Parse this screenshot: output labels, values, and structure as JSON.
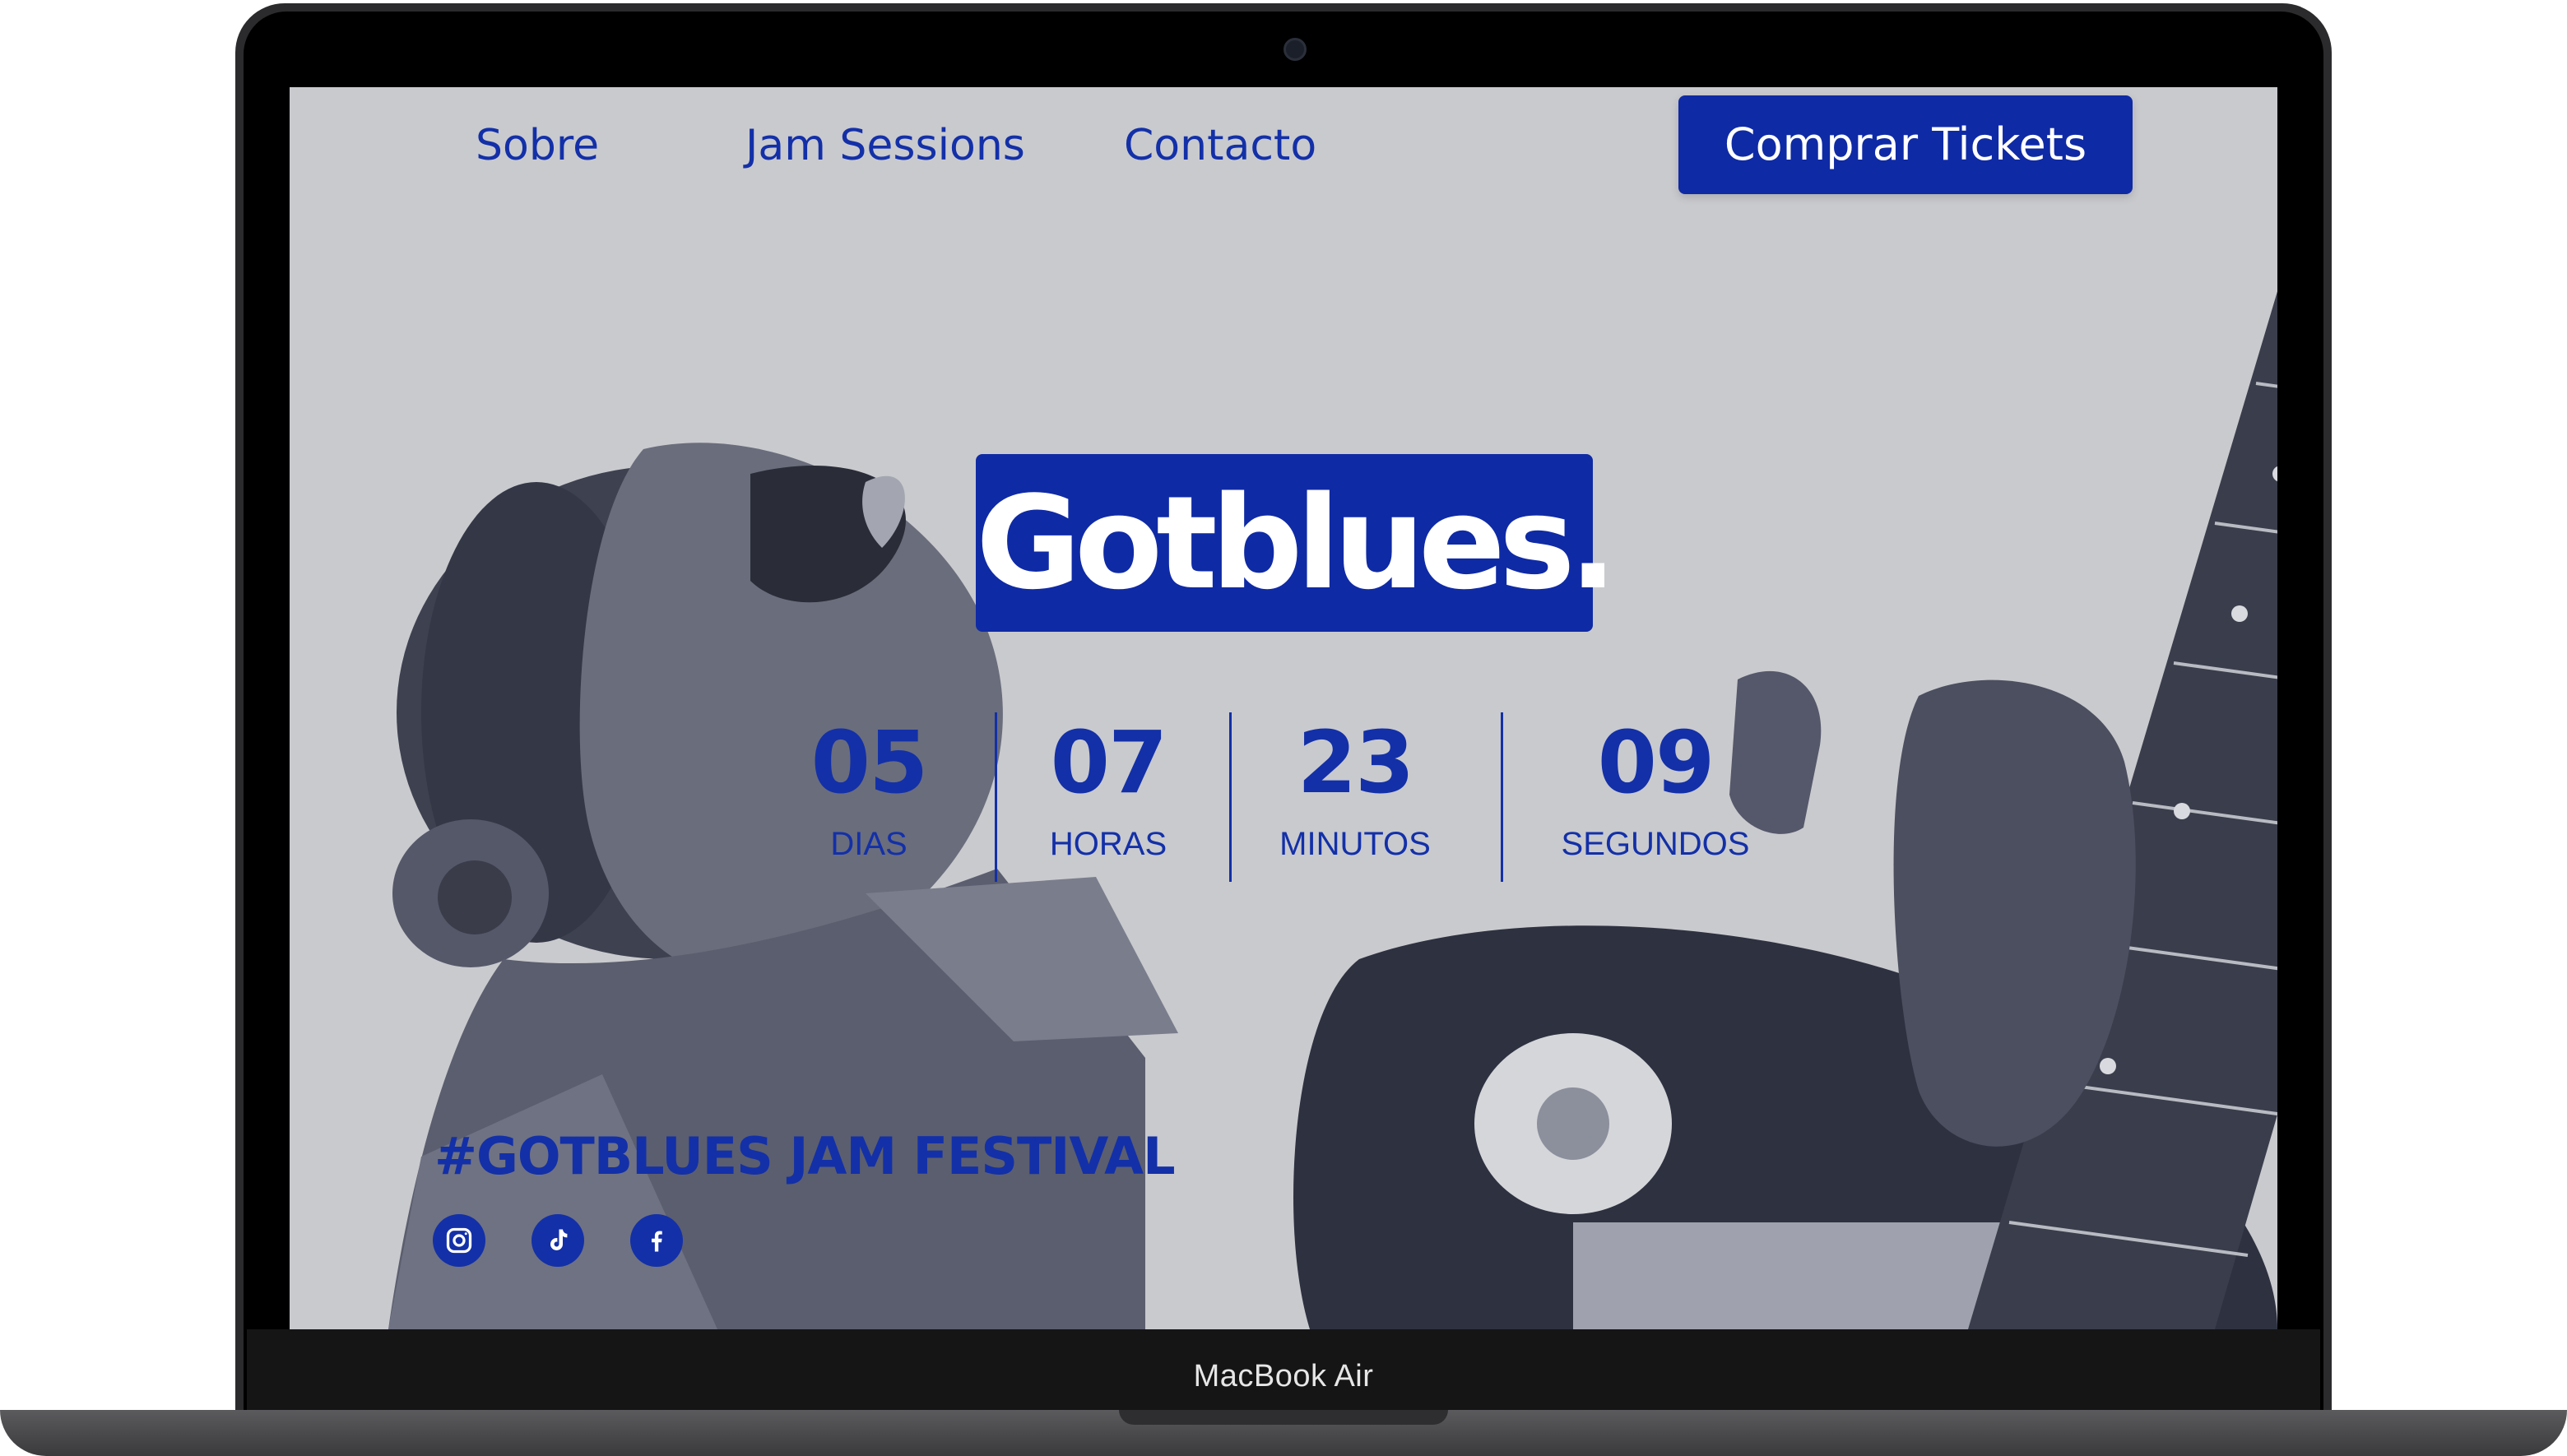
{
  "device": {
    "label": "MacBook Air"
  },
  "nav": {
    "links": [
      "Sobre",
      "Jam Sessions",
      "Contacto"
    ],
    "cta": "Comprar Tickets"
  },
  "hero": {
    "logo": "Gotblues.",
    "hashtag": "#GOTBLUES JAM FESTIVAL"
  },
  "countdown": [
    {
      "value": "05",
      "label": "DIAS"
    },
    {
      "value": "07",
      "label": "HORAS"
    },
    {
      "value": "23",
      "label": "MINUTOS"
    },
    {
      "value": "09",
      "label": "SEGUNDOS"
    }
  ],
  "social": [
    "instagram-icon",
    "tiktok-icon",
    "facebook-icon"
  ],
  "colors": {
    "brand_blue": "#0f2aa5",
    "text_blue": "#1330a8",
    "photo_tint": "#c8c9cd"
  }
}
